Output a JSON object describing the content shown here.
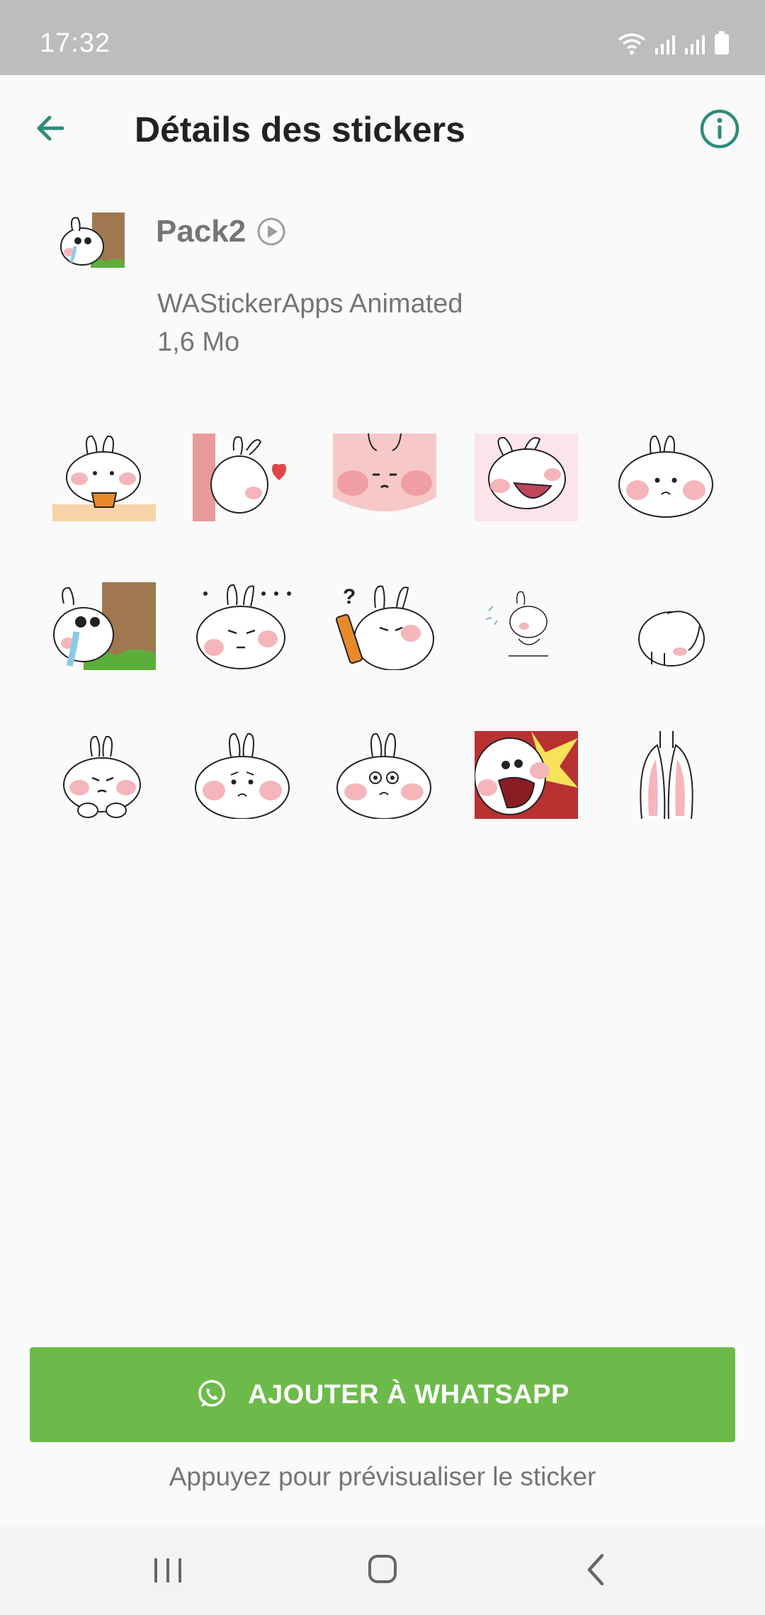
{
  "status_bar": {
    "time": "17:32"
  },
  "app_bar": {
    "title": "Détails des stickers"
  },
  "pack": {
    "name": "Pack2",
    "publisher": "WAStickerApps Animated",
    "size": "1,6 Mo"
  },
  "stickers": [
    {
      "name": "bunny-cup"
    },
    {
      "name": "bunny-heart"
    },
    {
      "name": "bunny-blush-closeup"
    },
    {
      "name": "bunny-laugh"
    },
    {
      "name": "bunny-pout"
    },
    {
      "name": "bunny-cry-tree"
    },
    {
      "name": "bunny-dots"
    },
    {
      "name": "bunny-phone-question"
    },
    {
      "name": "bunny-jump"
    },
    {
      "name": "bunny-peek"
    },
    {
      "name": "bunny-sulk"
    },
    {
      "name": "bunny-sad"
    },
    {
      "name": "bunny-nervous"
    },
    {
      "name": "bunny-shout"
    },
    {
      "name": "bunny-ears"
    }
  ],
  "actions": {
    "add_label": "AJOUTER À WHATSAPP",
    "hint": "Appuyez pour prévisualiser le sticker"
  },
  "colors": {
    "accent": "#2e8b7a",
    "add_button": "#6cbb4a",
    "status_bar": "#bdbdbd",
    "blush": "#f4b6ba"
  },
  "icons": [
    "back-arrow-icon",
    "info-icon",
    "play-icon",
    "whatsapp-icon",
    "recent-apps-icon",
    "home-icon",
    "back-icon"
  ]
}
